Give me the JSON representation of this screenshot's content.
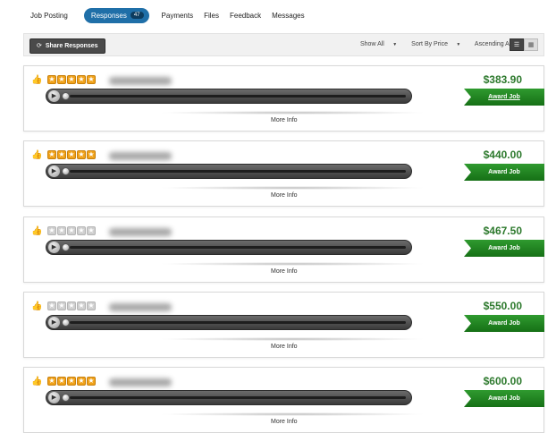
{
  "tabs": [
    {
      "label": "Job Posting",
      "active": false
    },
    {
      "label": "Responses",
      "active": true,
      "badge": "47"
    },
    {
      "label": "Payments",
      "active": false
    },
    {
      "label": "Files",
      "active": false
    },
    {
      "label": "Feedback",
      "active": false
    },
    {
      "label": "Messages",
      "active": false
    }
  ],
  "toolbar": {
    "share_label": "Share Responses",
    "share_icon": "refresh-icon",
    "show_label": "Show All",
    "sort_label": "Sort By Price",
    "order_label": "Ascending A-Z",
    "view_modes": [
      "list",
      "grid"
    ],
    "active_view": "list"
  },
  "responses": [
    {
      "price": "$383.90",
      "rating": 5,
      "rating_max": 5,
      "more_info": "More Info",
      "award_label": "Award Job"
    },
    {
      "price": "$440.00",
      "rating": 5,
      "rating_max": 5,
      "more_info": "More Info",
      "award_label": "Award Job"
    },
    {
      "price": "$467.50",
      "rating": 0,
      "rating_max": 5,
      "more_info": "More Info",
      "award_label": "Award Job"
    },
    {
      "price": "$550.00",
      "rating": 0,
      "rating_max": 5,
      "more_info": "More Info",
      "award_label": "Award Job"
    },
    {
      "price": "$600.00",
      "rating": 5,
      "rating_max": 5,
      "more_info": "More Info",
      "award_label": "Award Job"
    }
  ],
  "colors": {
    "tab_active": "#1f6fa8",
    "price": "#2e7a2e",
    "award": "#1f8a1f",
    "star_filled": "#f0a21a",
    "star_empty": "#cfcfcf"
  }
}
